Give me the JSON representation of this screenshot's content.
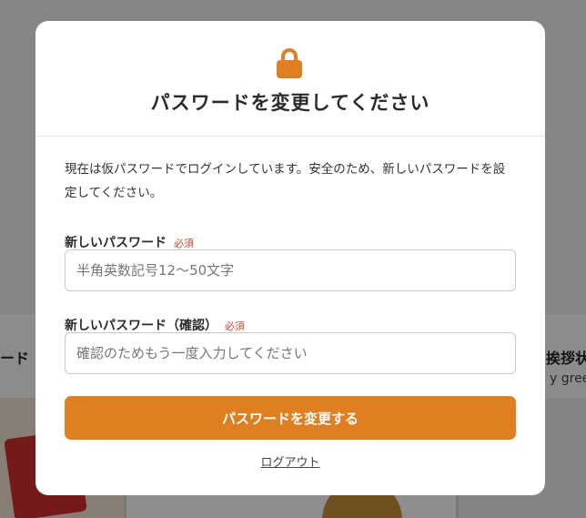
{
  "background": {
    "left_text": "ード",
    "right_text": "挨拶状",
    "right_sub": "y greeti"
  },
  "modal": {
    "icon": "lock-icon",
    "accent_color": "#e07f22",
    "title": "パスワードを変更してください",
    "description": "現在は仮パスワードでログインしています。安全のため、新しいパスワードを設定してください。",
    "new_password": {
      "label": "新しいパスワード",
      "required": "必須",
      "placeholder": "半角英数記号12〜50文字",
      "value": ""
    },
    "confirm_password": {
      "label": "新しいパスワード（確認）",
      "required": "必須",
      "placeholder": "確認のためもう一度入力してください",
      "value": ""
    },
    "submit_label": "パスワードを変更する",
    "logout_label": "ログアウト"
  }
}
